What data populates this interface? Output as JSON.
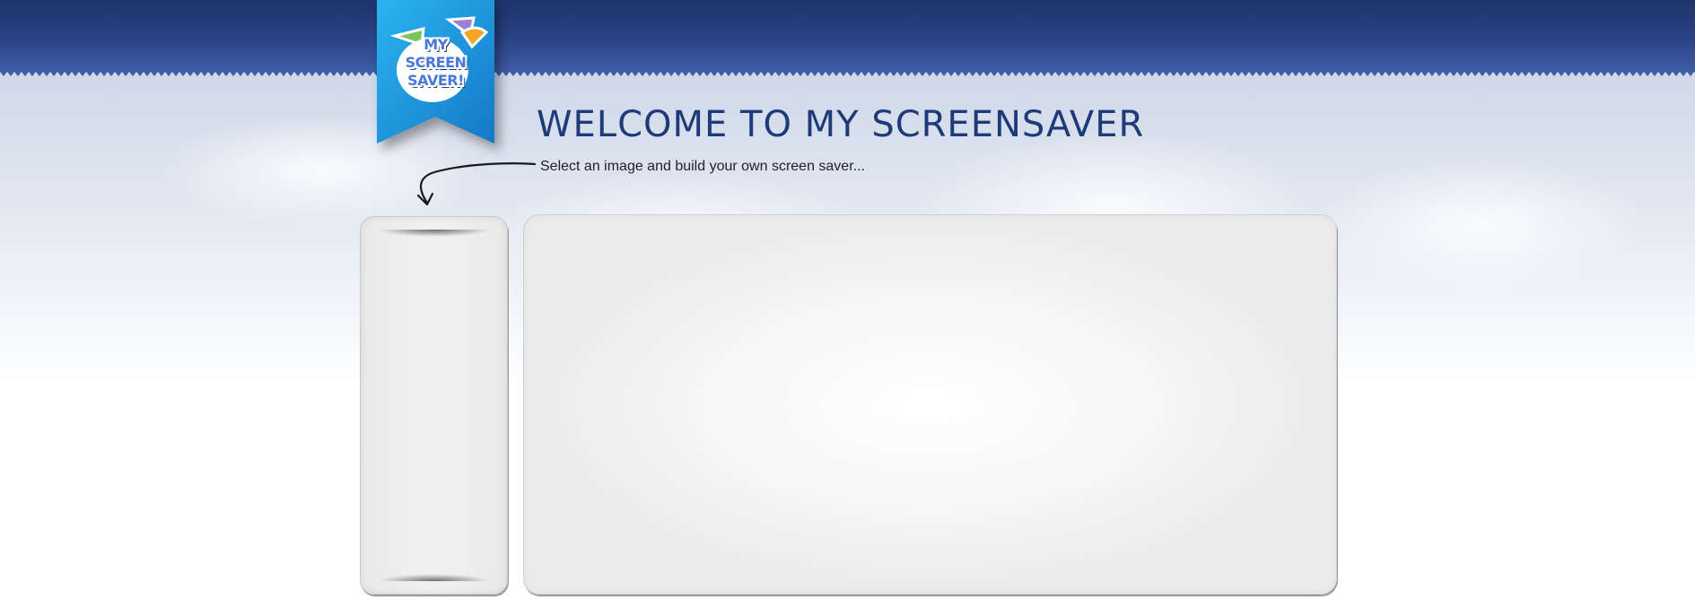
{
  "logo": {
    "text": "MY\nSCREEN\nSAVER!"
  },
  "header": {
    "title": "WELCOME TO MY SCREENSAVER",
    "subtitle": "Select an image and build your own screen saver..."
  },
  "colors": {
    "header_bar": "#2a4486",
    "ribbon": "#1e8fd8",
    "title": "#1f3a78",
    "panel_bg": "#f0f0f0"
  },
  "icons": {
    "arrow": "curved-arrow-down-left"
  }
}
